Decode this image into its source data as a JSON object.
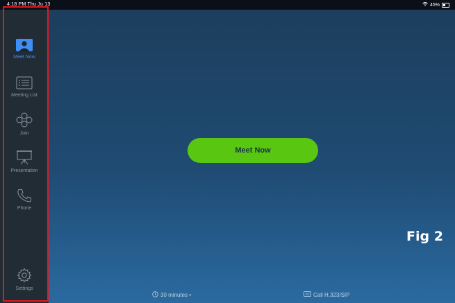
{
  "status_bar": {
    "time": "4:18 PM  Thu Ju 13",
    "battery_percent": "45%",
    "icons": [
      "wifi-icon",
      "battery-icon"
    ]
  },
  "sidebar": {
    "items": [
      {
        "label": "Meet Now",
        "icon": "meet-now-icon",
        "active": true
      },
      {
        "label": "Meeting List",
        "icon": "meeting-list-icon",
        "active": false
      },
      {
        "label": "Join",
        "icon": "join-icon",
        "active": false
      },
      {
        "label": "Presentation",
        "icon": "presentation-icon",
        "active": false
      },
      {
        "label": "Phone",
        "icon": "phone-icon",
        "active": false
      },
      {
        "label": "Settings",
        "icon": "gear-icon",
        "active": false
      }
    ]
  },
  "main": {
    "meet_now_button": "Meet Now",
    "duration": "30 minutes •",
    "call_label": "Call H.323/SIP"
  },
  "annotation": {
    "figure_label": "Fig 2",
    "highlight_color": "#e8161c"
  },
  "colors": {
    "sidebar_bg": "#222c35",
    "accent": "#3f8ef5",
    "button": "#59c712"
  }
}
